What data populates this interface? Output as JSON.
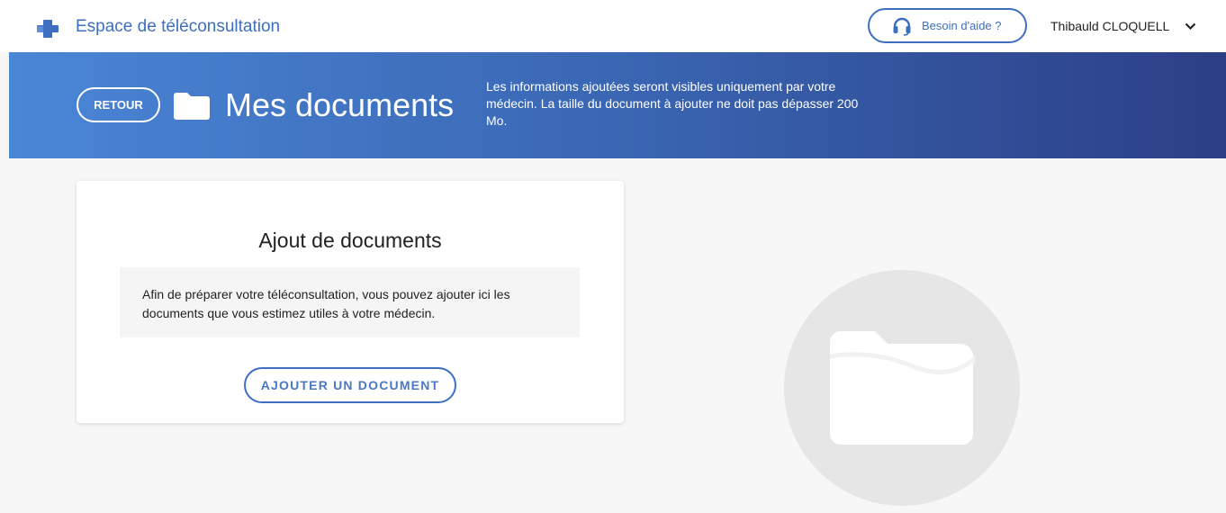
{
  "header": {
    "brand_icon": "medical-cross-icon",
    "title": "Espace de téléconsultation",
    "help_icon": "headset-icon",
    "help_label": "Besoin d'aide ?",
    "user_name": "Thibauld CLOQUELL",
    "user_menu_icon": "chevron-down-icon"
  },
  "banner": {
    "back_label": "RETOUR",
    "folder_icon": "folder-icon",
    "title": "Mes documents",
    "info": "Les informations ajoutées seront visibles uniquement par votre médecin. La taille du document à ajouter ne doit pas dépasser 200 Mo."
  },
  "card": {
    "title": "Ajout de documents",
    "note": "Afin de préparer votre téléconsultation, vous pouvez ajouter ici les documents que vous estimez utiles à votre médecin.",
    "add_label": "AJOUTER UN DOCUMENT"
  },
  "illustration": {
    "icon": "folder-icon"
  },
  "colors": {
    "accent": "#3d6fc0",
    "banner_start": "#4a86d6",
    "banner_end": "#2c3f86",
    "background": "#f7f7f7"
  }
}
